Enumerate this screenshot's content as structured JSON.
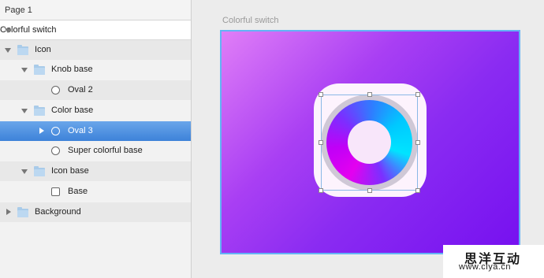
{
  "sidebar": {
    "page_label": "Page 1",
    "artboard_label": "Colorful switch",
    "layers": {
      "icon": "Icon",
      "knob_base": "Knob base",
      "oval2": "Oval 2",
      "color_base": "Color base",
      "oval3": "Oval 3",
      "super_colorful_base": "Super colorful base",
      "icon_base": "Icon base",
      "base": "Base",
      "background": "Background"
    },
    "selected_layer": "Oval 3"
  },
  "canvas": {
    "artboard_title": "Colorful switch",
    "colors": {
      "gradient_start": "#e07ef7",
      "gradient_end": "#7610f0",
      "selection": "#63b3f5"
    }
  },
  "watermark": {
    "brand": "思洋互动",
    "url": "www.ciya.cn"
  }
}
